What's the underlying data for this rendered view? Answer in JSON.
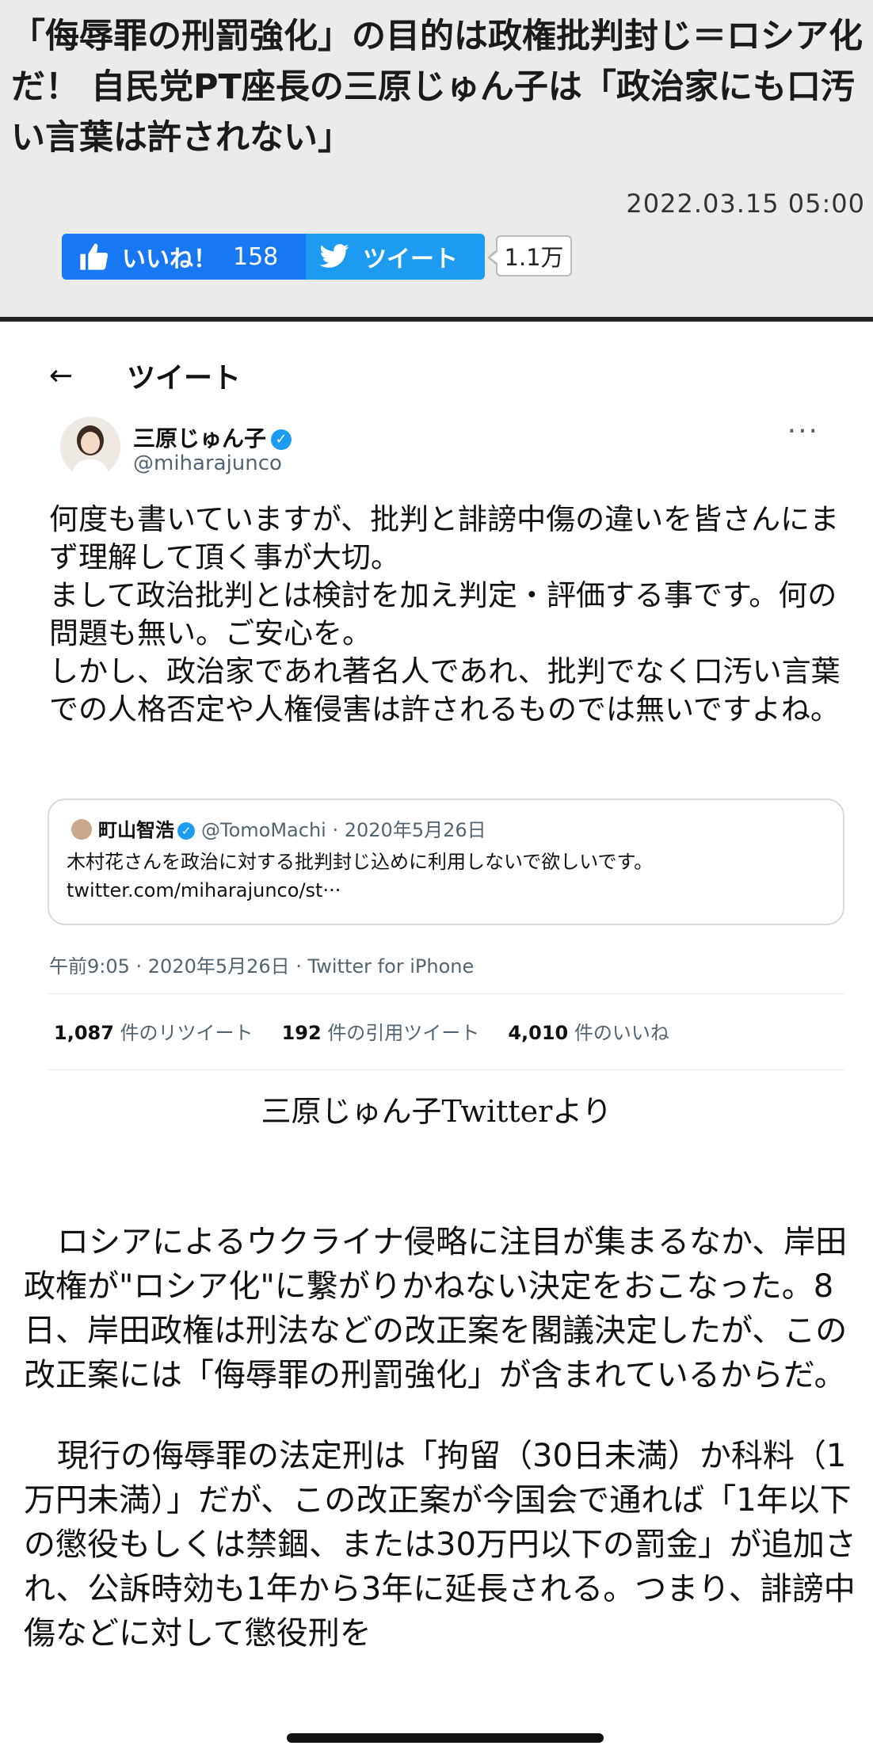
{
  "header": {
    "headline": "「侮辱罪の刑罰強化」の目的は政権批判封じ＝ロシア化だ！ 自民党PT座長の三原じゅん子は「政治家にも口汚い言葉は許されない」",
    "datetime": "2022.03.15 05:00",
    "like": {
      "label": "いいね！",
      "count": "158"
    },
    "tweet": {
      "label": "ツイート",
      "count": "1.1万"
    }
  },
  "tweet": {
    "screen_title": "ツイート",
    "back_icon": "←",
    "author_name": "三原じゅん子",
    "author_handle": "@miharajunco",
    "more_icon": "···",
    "body_lines": [
      "何度も書いていますが、批判と誹謗中傷の違いを皆さんにまず理解して頂く事が大切。",
      "まして政治批判とは検討を加え判定・評価する事です。何の問題も無い。ご安心を。",
      "しかし、政治家であれ著名人であれ、批判でなく口汚い言葉での人格否定や人権侵害は許されるものでは無いですよね。"
    ],
    "quote": {
      "name": "町山智浩",
      "handle": "@TomoMachi",
      "separator": "·",
      "date": "2020年5月26日",
      "text": "木村花さんを政治に対する批判封じ込めに利用しないで欲しいです。",
      "link": "twitter.com/miharajunco/st···"
    },
    "timestamp": "午前9:05 · 2020年5月26日 · Twitter for iPhone",
    "stats": {
      "retweets_count": "1,087",
      "retweets_label": "件のリツイート",
      "quotes_count": "192",
      "quotes_label": "件の引用ツイート",
      "likes_count": "4,010",
      "likes_label": "件のいいね"
    }
  },
  "caption": "三原じゅん子Twitterより",
  "article": {
    "paragraphs": [
      "ロシアによるウクライナ侵略に注目が集まるなか、岸田政権が\"ロシア化\"に繋がりかねない決定をおこなった。8日、岸田政権は刑法などの改正案を閣議決定したが、この改正案には「侮辱罪の刑罰強化」が含まれているからだ。",
      "現行の侮辱罪の法定刑は「拘留（30日未満）か科料（1万円未満）」だが、この改正案が今国会で通れば「1年以下の懲役もしくは禁錮、または30万円以下の罰金」が追加され、公訴時効も1年から3年に延長される。つまり、誹謗中傷などに対して懲役刑を"
    ]
  },
  "colors": {
    "header_bg": "#ebebeb",
    "facebook_blue": "#1877f2",
    "twitter_blue": "#1d9bf0"
  },
  "icons": {
    "like": "thumbs-up-icon",
    "tweet": "twitter-bird-icon",
    "back": "back-arrow-icon",
    "more": "more-dots-icon",
    "verified": "verified-badge-icon"
  }
}
